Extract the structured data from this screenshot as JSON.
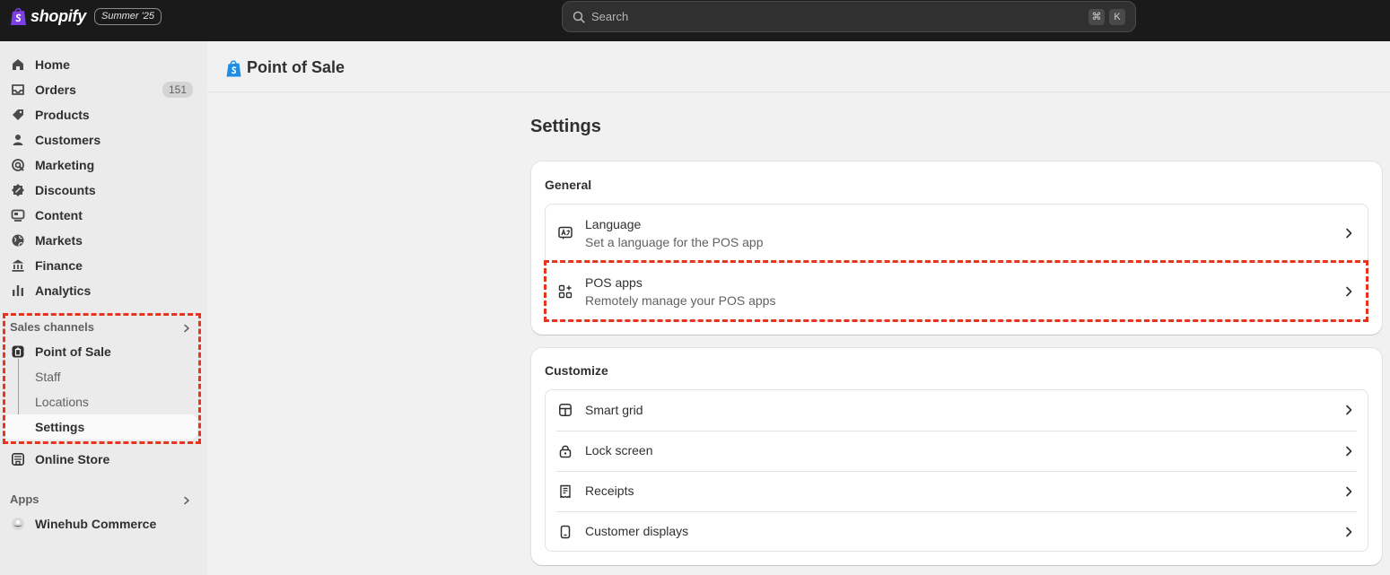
{
  "topbar": {
    "logo_text": "shopify",
    "version_badge": "Summer '25",
    "search_placeholder": "Search",
    "shortcut_keys": [
      "⌘",
      "K"
    ]
  },
  "sidebar": {
    "items": [
      {
        "label": "Home",
        "icon": "home-icon"
      },
      {
        "label": "Orders",
        "icon": "inbox-icon",
        "badge": "151"
      },
      {
        "label": "Products",
        "icon": "tag-icon"
      },
      {
        "label": "Customers",
        "icon": "person-icon"
      },
      {
        "label": "Marketing",
        "icon": "target-icon"
      },
      {
        "label": "Discounts",
        "icon": "discount-icon"
      },
      {
        "label": "Content",
        "icon": "content-icon"
      },
      {
        "label": "Markets",
        "icon": "globe-icon"
      },
      {
        "label": "Finance",
        "icon": "bank-icon"
      },
      {
        "label": "Analytics",
        "icon": "bar-chart-icon"
      }
    ],
    "sales_channels_label": "Sales channels",
    "pos": {
      "label": "Point of Sale",
      "subitems": [
        "Staff",
        "Locations",
        "Settings"
      ],
      "active_subitem": "Settings"
    },
    "online_store_label": "Online Store",
    "apps_label": "Apps",
    "apps": [
      {
        "label": "Winehub Commerce"
      }
    ]
  },
  "page": {
    "header_title": "Point of Sale",
    "settings_title": "Settings",
    "general": {
      "title": "General",
      "rows": [
        {
          "title": "Language",
          "subtitle": "Set a language for the POS app",
          "icon": "language-icon"
        },
        {
          "title": "POS apps",
          "subtitle": "Remotely manage your POS apps",
          "icon": "apps-icon"
        }
      ]
    },
    "customize": {
      "title": "Customize",
      "rows": [
        {
          "title": "Smart grid",
          "icon": "smart-grid-icon"
        },
        {
          "title": "Lock screen",
          "icon": "lock-icon"
        },
        {
          "title": "Receipts",
          "icon": "receipt-icon"
        },
        {
          "title": "Customer displays",
          "icon": "display-icon"
        }
      ]
    }
  },
  "colors": {
    "topbar_bg": "#1a1a1a",
    "sidebar_bg": "#ebebeb",
    "main_bg": "#f1f1f1",
    "highlight_dashed": "#e8341c",
    "logo_purple": "#95bf47"
  }
}
